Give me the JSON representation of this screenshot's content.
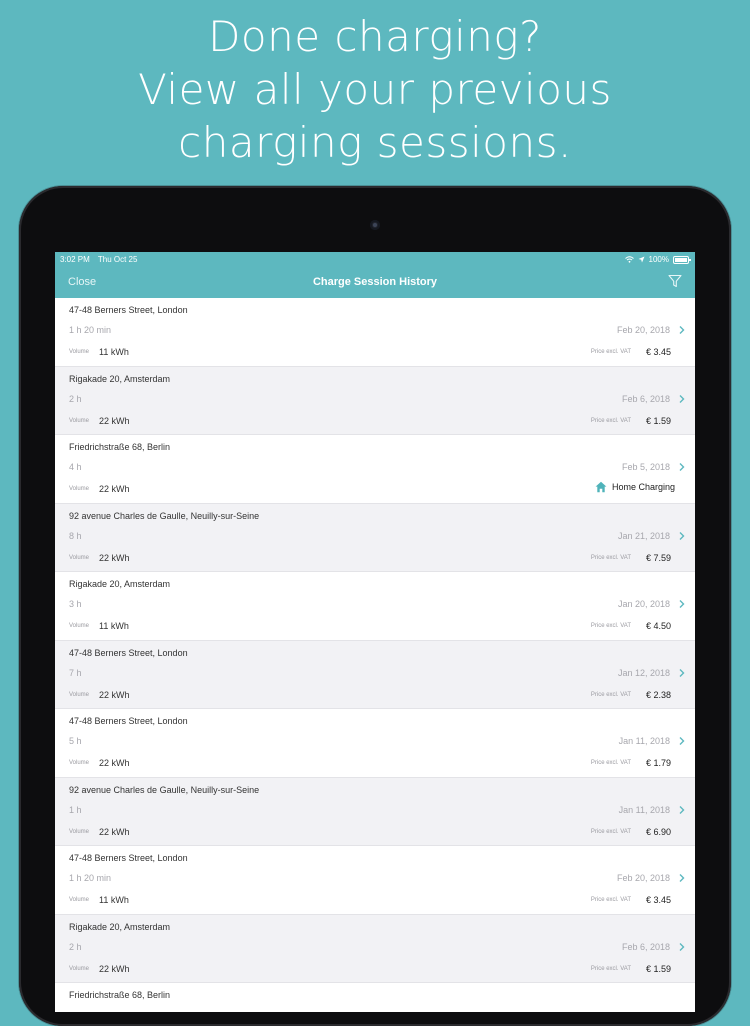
{
  "headline": [
    "Done charging?",
    "View all your previous",
    "charging sessions."
  ],
  "status_bar": {
    "time": "3:02 PM",
    "date": "Thu Oct 25",
    "battery": "100%"
  },
  "nav": {
    "close_label": "Close",
    "title": "Charge Session History",
    "filter_icon": "filter-icon"
  },
  "colors": {
    "accent": "#5db8bf",
    "home_icon": "#4fb3ba"
  },
  "volume_label": "Volume",
  "price_label": "Price excl. VAT",
  "sessions": [
    {
      "address": "47-48 Berners Street, London",
      "duration": "1 h 20 min",
      "date": "Feb 20, 2018",
      "volume": "11 kWh",
      "price": "€ 3.45"
    },
    {
      "address": "Rigakade 20, Amsterdam",
      "duration": "2 h",
      "date": "Feb 6, 2018",
      "volume": "22 kWh",
      "price": "€ 1.59"
    },
    {
      "address": "Friedrichstraße 68, Berlin",
      "duration": "4 h",
      "date": "Feb 5, 2018",
      "volume": "22 kWh",
      "home_label": "Home Charging"
    },
    {
      "address": "92 avenue Charles de Gaulle, Neuilly-sur-Seine",
      "duration": "8 h",
      "date": "Jan 21, 2018",
      "volume": "22 kWh",
      "price": "€ 7.59"
    },
    {
      "address": "Rigakade 20, Amsterdam",
      "duration": "3 h",
      "date": "Jan 20, 2018",
      "volume": "11 kWh",
      "price": "€ 4.50"
    },
    {
      "address": "47-48 Berners Street, London",
      "duration": "7 h",
      "date": "Jan 12, 2018",
      "volume": "22 kWh",
      "price": "€ 2.38"
    },
    {
      "address": "47-48 Berners Street, London",
      "duration": "5 h",
      "date": "Jan 11, 2018",
      "volume": "22 kWh",
      "price": "€ 1.79"
    },
    {
      "address": "92 avenue Charles de Gaulle, Neuilly-sur-Seine",
      "duration": "1 h",
      "date": "Jan 11, 2018",
      "volume": "22 kWh",
      "price": "€ 6.90"
    },
    {
      "address": "47-48 Berners Street, London",
      "duration": "1 h 20 min",
      "date": "Feb 20, 2018",
      "volume": "11 kWh",
      "price": "€ 3.45"
    },
    {
      "address": "Rigakade 20, Amsterdam",
      "duration": "2 h",
      "date": "Feb 6, 2018",
      "volume": "22 kWh",
      "price": "€ 1.59"
    },
    {
      "address": "Friedrichstraße 68, Berlin",
      "duration": "",
      "date": "",
      "volume": "",
      "price": ""
    }
  ]
}
